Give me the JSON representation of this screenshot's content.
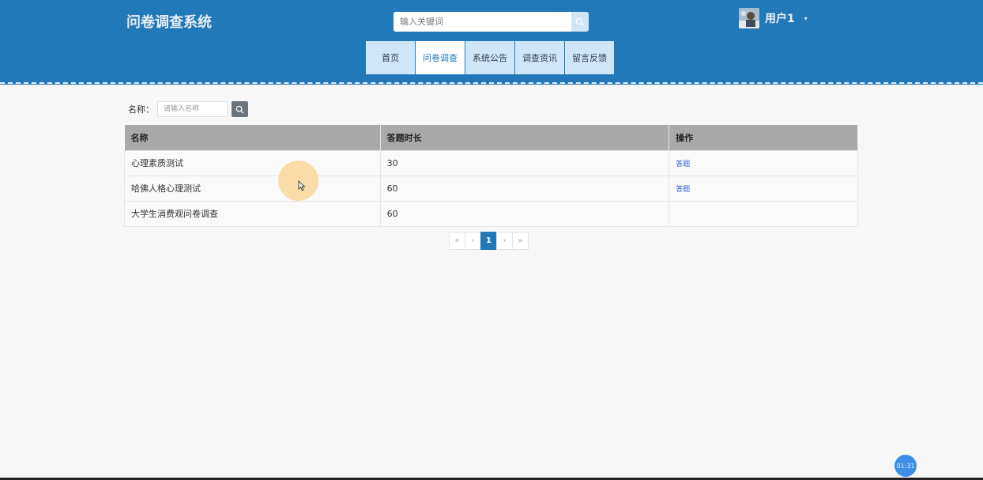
{
  "header": {
    "site_title": "问卷调查系统",
    "search_placeholder": "输入关键词",
    "username": "用户1",
    "caret": "▾"
  },
  "nav": {
    "items": [
      {
        "label": "首页",
        "active": false
      },
      {
        "label": "问卷调查",
        "active": true
      },
      {
        "label": "系统公告",
        "active": false
      },
      {
        "label": "调查资讯",
        "active": false
      },
      {
        "label": "留言反馈",
        "active": false
      }
    ]
  },
  "filter": {
    "label": "名称：",
    "placeholder": "请输入名称"
  },
  "table": {
    "headers": [
      "名称",
      "答题时长",
      "操作"
    ],
    "rows": [
      {
        "name": "心理素质测试",
        "duration": "30",
        "action": "答题"
      },
      {
        "name": "哈佛人格心理测试",
        "duration": "60",
        "action": "答题"
      },
      {
        "name": "大学生消费观问卷调查",
        "duration": "60",
        "action": ""
      }
    ]
  },
  "pagination": {
    "first": "«",
    "prev": "‹",
    "current": "1",
    "next": "›",
    "last": "»"
  },
  "timer": "01:31",
  "colors": {
    "header_bg": "#2179b9",
    "nav_bg": "#cfe5f8",
    "table_header_bg": "#a9a9a9",
    "link": "#3a5fd8"
  }
}
